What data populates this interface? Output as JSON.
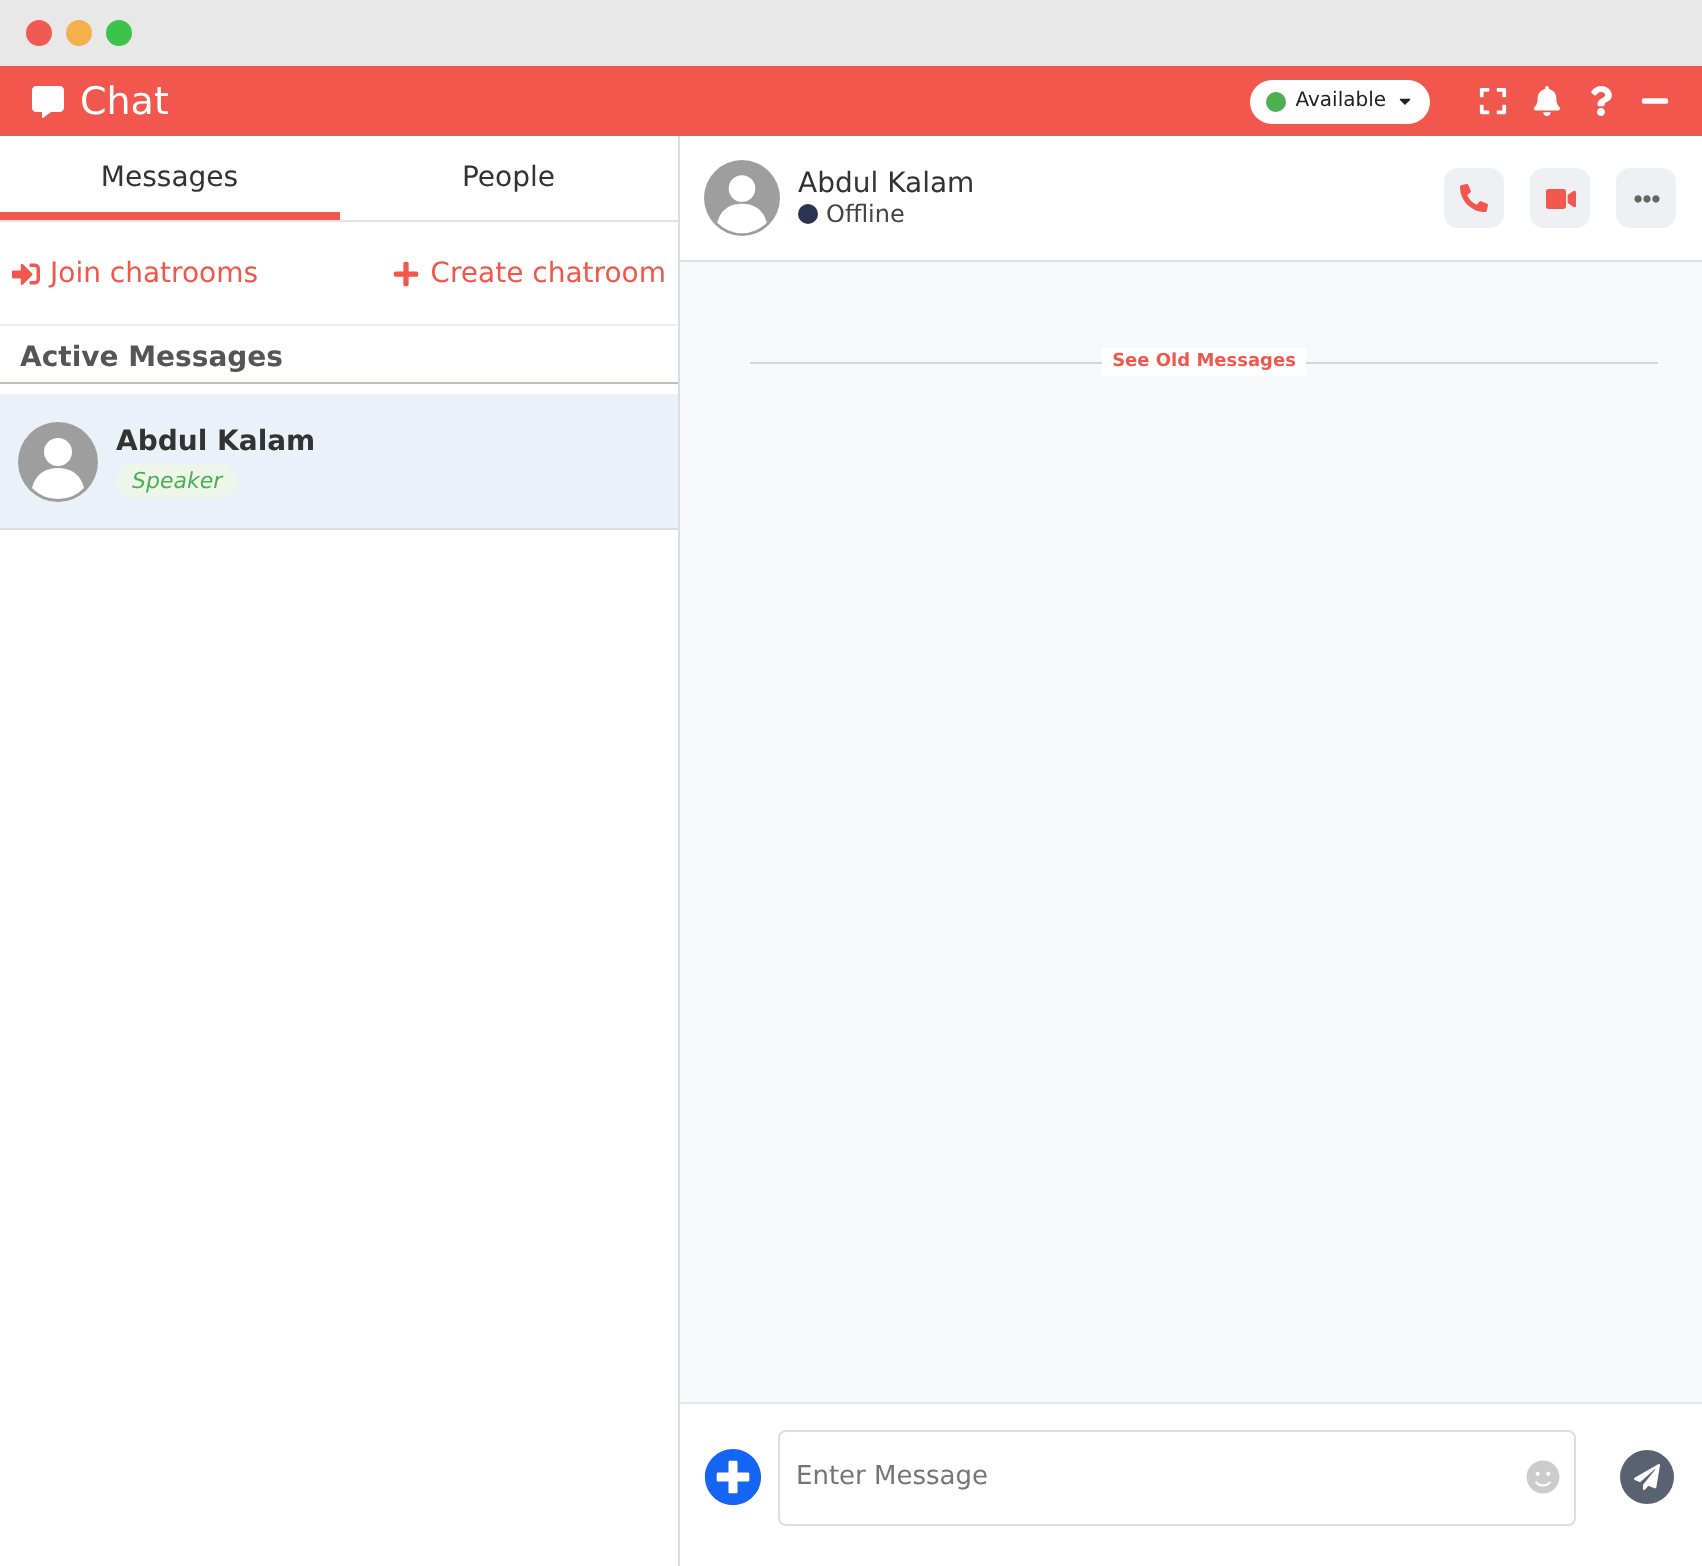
{
  "window": {
    "title": "Chat"
  },
  "status": {
    "label": "Available",
    "color": "#4caf50"
  },
  "tabs": [
    {
      "label": "Messages",
      "selected": true
    },
    {
      "label": "People",
      "selected": false
    }
  ],
  "actions": {
    "join": "Join chatrooms",
    "create": "Create chatroom"
  },
  "section_title": "Active Messages",
  "conversations": [
    {
      "name": "Abdul Kalam",
      "role": "Speaker",
      "selected": true
    }
  ],
  "contact": {
    "name": "Abdul Kalam",
    "status": {
      "label": "Offline",
      "color": "#2e3350"
    }
  },
  "see_old": "See Old Messages",
  "composer": {
    "placeholder": "Enter Message"
  }
}
